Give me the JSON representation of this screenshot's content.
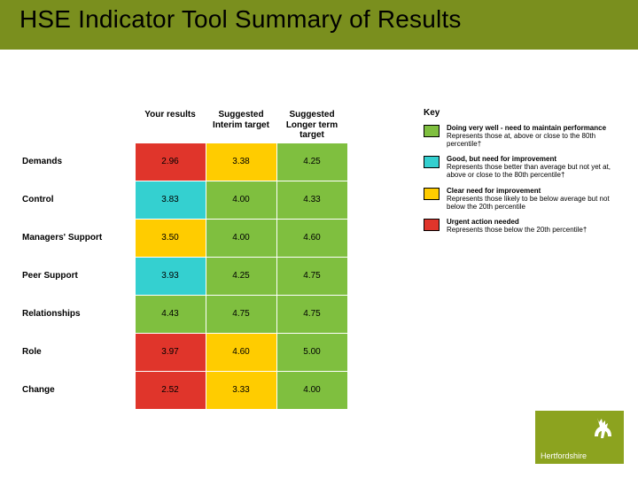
{
  "title": "HSE Indicator Tool Summary of Results",
  "columns": {
    "row_header": "",
    "your_results": "Your results",
    "interim": "Suggested Interim target",
    "longer": "Suggested Longer term target"
  },
  "rows": [
    {
      "label": "Demands",
      "your": "2.96",
      "your_c": "c-red",
      "interim": "3.38",
      "interim_c": "c-yellow",
      "longer": "4.25",
      "longer_c": "c-green"
    },
    {
      "label": "Control",
      "your": "3.83",
      "your_c": "c-cyan",
      "interim": "4.00",
      "interim_c": "c-green",
      "longer": "4.33",
      "longer_c": "c-green"
    },
    {
      "label": "Managers' Support",
      "your": "3.50",
      "your_c": "c-yellow",
      "interim": "4.00",
      "interim_c": "c-green",
      "longer": "4.60",
      "longer_c": "c-green"
    },
    {
      "label": "Peer Support",
      "your": "3.93",
      "your_c": "c-cyan",
      "interim": "4.25",
      "interim_c": "c-green",
      "longer": "4.75",
      "longer_c": "c-green"
    },
    {
      "label": "Relationships",
      "your": "4.43",
      "your_c": "c-green",
      "interim": "4.75",
      "interim_c": "c-green",
      "longer": "4.75",
      "longer_c": "c-green"
    },
    {
      "label": "Role",
      "your": "3.97",
      "your_c": "c-red",
      "interim": "4.60",
      "interim_c": "c-yellow",
      "longer": "5.00",
      "longer_c": "c-green"
    },
    {
      "label": "Change",
      "your": "2.52",
      "your_c": "c-red",
      "interim": "3.33",
      "interim_c": "c-yellow",
      "longer": "4.00",
      "longer_c": "c-green"
    }
  ],
  "key": {
    "title": "Key",
    "items": [
      {
        "color": "c-green",
        "bold": "Doing very well - need to maintain performance",
        "rest": "Represents those at, above or close to the 80th percentile†"
      },
      {
        "color": "c-cyan",
        "bold": "Good, but need for improvement",
        "rest": "Represents those better than average but not yet at, above or close to the 80th percentile†"
      },
      {
        "color": "c-yellow",
        "bold": "Clear need for improvement",
        "rest": "Represents those likely to be below average but not below the 20th percentile"
      },
      {
        "color": "c-red",
        "bold": "Urgent action needed",
        "rest": "Represents those below the 20th percentile†"
      }
    ]
  },
  "logo_text": "Hertfordshire",
  "chart_data": {
    "type": "table",
    "columns": [
      "Category",
      "Your results",
      "Suggested Interim target",
      "Suggested Longer term target"
    ],
    "data": [
      [
        "Demands",
        2.96,
        3.38,
        4.25
      ],
      [
        "Control",
        3.83,
        4.0,
        4.33
      ],
      [
        "Managers' Support",
        3.5,
        4.0,
        4.6
      ],
      [
        "Peer Support",
        3.93,
        4.25,
        4.75
      ],
      [
        "Relationships",
        4.43,
        4.75,
        4.75
      ],
      [
        "Role",
        3.97,
        4.6,
        5.0
      ],
      [
        "Change",
        2.52,
        3.33,
        4.0
      ]
    ],
    "color_coding": {
      "green": "≥80th percentile",
      "cyan": "above average, <80th",
      "yellow": "below average, >20th",
      "red": "≤20th percentile"
    }
  }
}
